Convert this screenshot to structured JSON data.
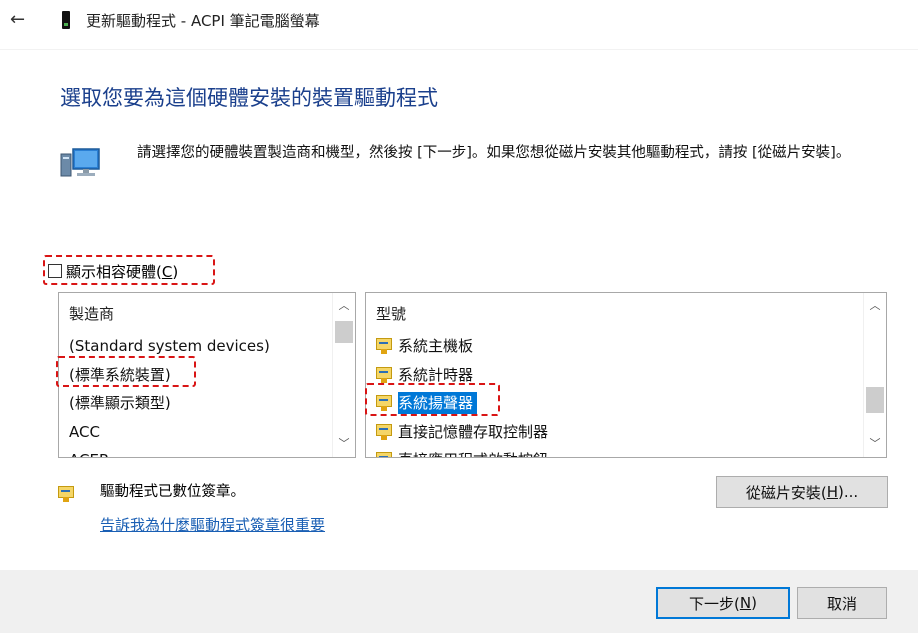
{
  "window": {
    "back_icon": "arrow-left-icon",
    "device_icon": "device-icon",
    "title": "更新驅動程式 - ACPI 筆記電腦螢幕"
  },
  "heading": "選取您要為這個硬體安裝的裝置驅動程式",
  "instruction": "請選擇您的硬體裝置製造商和機型，然後按 [下一步]。如果您想從磁片安裝其他驅動程式，請按 [從磁片安裝]。",
  "compat": {
    "label": "顯示相容硬體(",
    "accel": "C",
    "label_end": ")",
    "checked": false
  },
  "manufacturer": {
    "header": "製造商",
    "items": [
      "(Standard system devices)",
      "(標準系統裝置)",
      "(標準顯示類型)",
      "ACC",
      "ACER"
    ],
    "selected_index": 1
  },
  "model": {
    "header": "型號",
    "items": [
      "系統主機板",
      "系統計時器",
      "系統揚聲器",
      "直接記憶體存取控制器",
      "直接應用程式啟動按鈕"
    ],
    "selected_index": 2
  },
  "signed": {
    "icon": "signed-driver-icon",
    "text": "驅動程式已數位簽章。",
    "link": "告訴我為什麼驅動程式簽章很重要"
  },
  "buttons": {
    "have_disk": "從磁片安裝(",
    "have_disk_accel": "H",
    "have_disk_end": ")...",
    "next": "下一步(",
    "next_accel": "N",
    "next_end": ")",
    "cancel": "取消"
  },
  "colors": {
    "accent": "#0078d7",
    "heading": "#1a3f8c",
    "link": "#1a5fb4",
    "highlight_dash": "#d91515"
  }
}
